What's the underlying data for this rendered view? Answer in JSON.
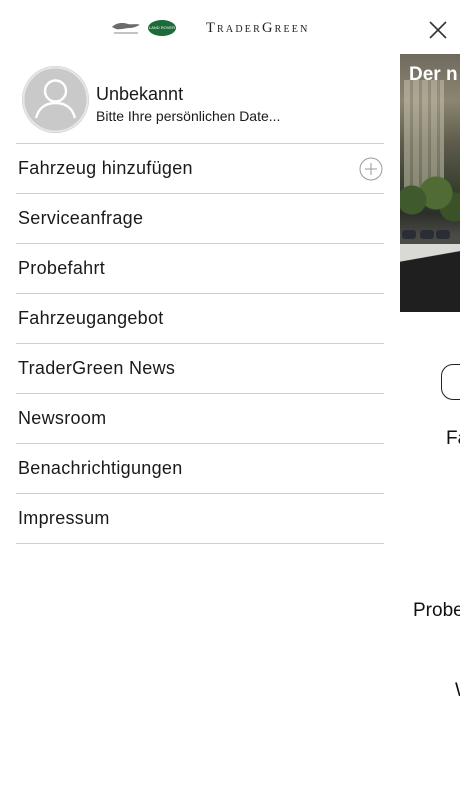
{
  "brand": {
    "logo1": "jaguar-logo",
    "logo2_text": "LAND ROVER",
    "name": "TraderGreen"
  },
  "profile": {
    "name": "Unbekannt",
    "subtitle": "Bitte Ihre persönlichen Date..."
  },
  "menu": [
    {
      "label": "Fahrzeug hinzufügen",
      "icon": "plus-circle-icon"
    },
    {
      "label": "Serviceanfrage"
    },
    {
      "label": "Probefahrt"
    },
    {
      "label": "Fahrzeugangebot"
    },
    {
      "label": "TraderGreen News"
    },
    {
      "label": "Newsroom"
    },
    {
      "label": "Benachrichtigungen"
    },
    {
      "label": "Impressum"
    }
  ],
  "underlay": {
    "hero_text": "Der n",
    "peek_1": "Fa",
    "peek_2": "Probe",
    "peek_3": "W",
    "close_icon": "close-icon"
  },
  "colors": {
    "divider": "#cfcfcf",
    "avatar": "#c9c9c9",
    "logo_green": "#1e6b3a"
  }
}
